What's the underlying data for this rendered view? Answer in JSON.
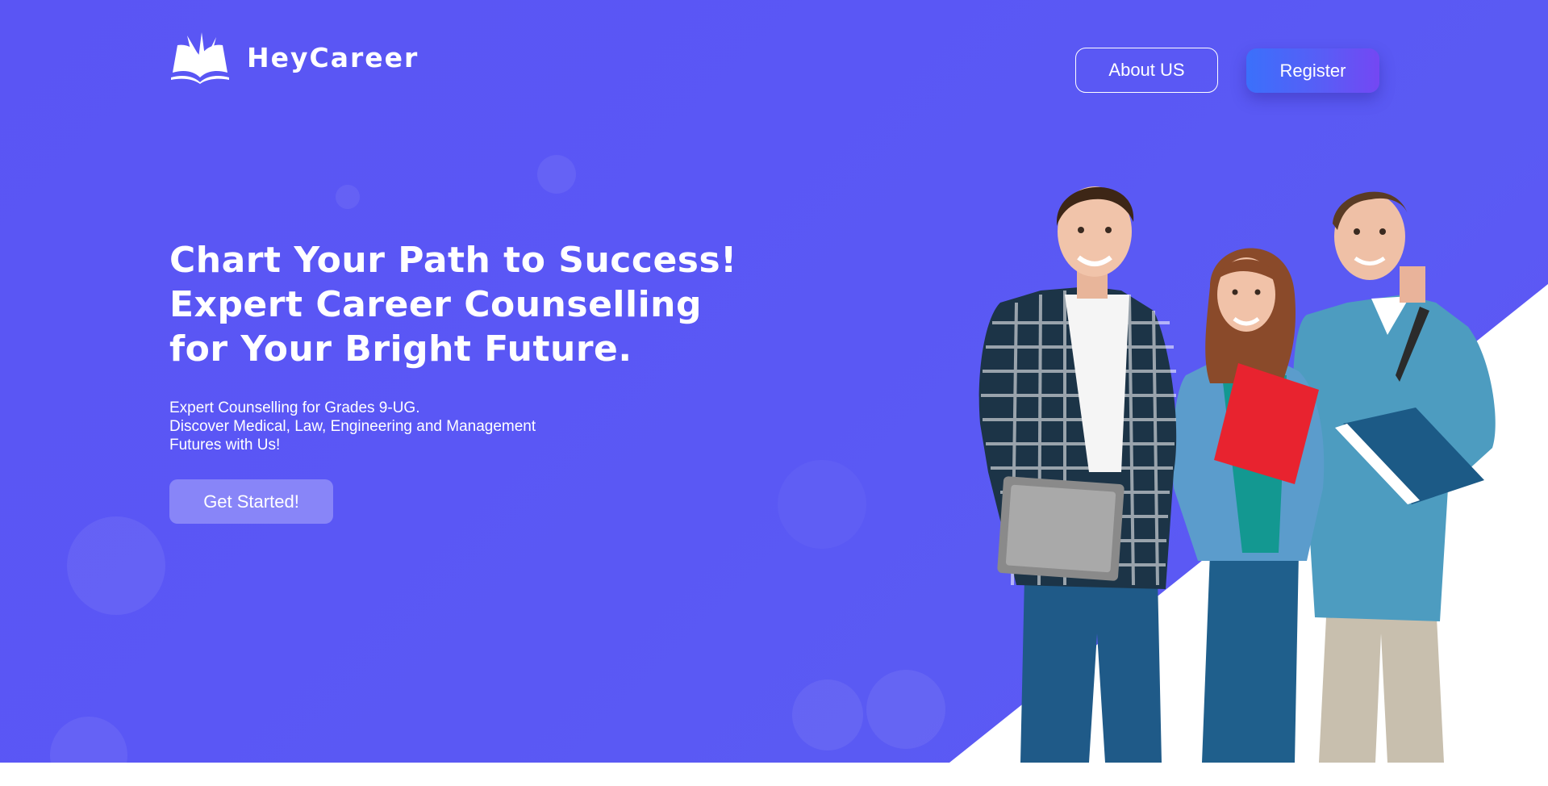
{
  "brand": {
    "name": "HeyCareer",
    "logo_icon": "open-book-icon"
  },
  "nav": {
    "about_label": "About US",
    "register_label": "Register"
  },
  "hero": {
    "headline_lines": [
      "Chart Your Path to Success!",
      "Expert Career Counselling",
      "for Your Bright Future."
    ],
    "subtext_lines": [
      "Expert Counselling for Grades 9-UG.",
      "Discover Medical, Law, Engineering and Management",
      "Futures with Us!"
    ],
    "cta_label": "Get Started!"
  },
  "colors": {
    "background": "#5a57f5",
    "accent_gradient_start": "#3b70fb",
    "accent_gradient_end": "#7447f3",
    "text": "#ffffff"
  }
}
